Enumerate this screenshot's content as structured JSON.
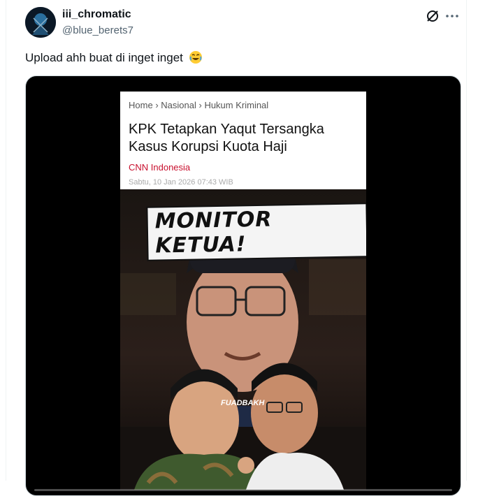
{
  "author": {
    "display_name": "iii_chromatic",
    "handle": "@blue_berets7"
  },
  "post": {
    "text": "Upload ahh buat di inget inget",
    "emoji": "face-with-tears-of-joy"
  },
  "icons": {
    "grok": "grok-icon",
    "more": "more-icon"
  },
  "media": {
    "news": {
      "breadcrumb": [
        "Home",
        "Nasional",
        "Hukum Kriminal"
      ],
      "headline": "KPK Tetapkan Yaqut Tersangka Kasus Korupsi Kuota Haji",
      "source": "CNN Indonesia",
      "date": "Sabtu, 10 Jan 2026 07:43 WIB"
    },
    "sticker_text": "MONITOR KETUA!",
    "watermark": "FUADBAKH"
  },
  "colors": {
    "text_primary": "#0f1419",
    "text_secondary": "#536471",
    "news_source": "#c8102e"
  }
}
